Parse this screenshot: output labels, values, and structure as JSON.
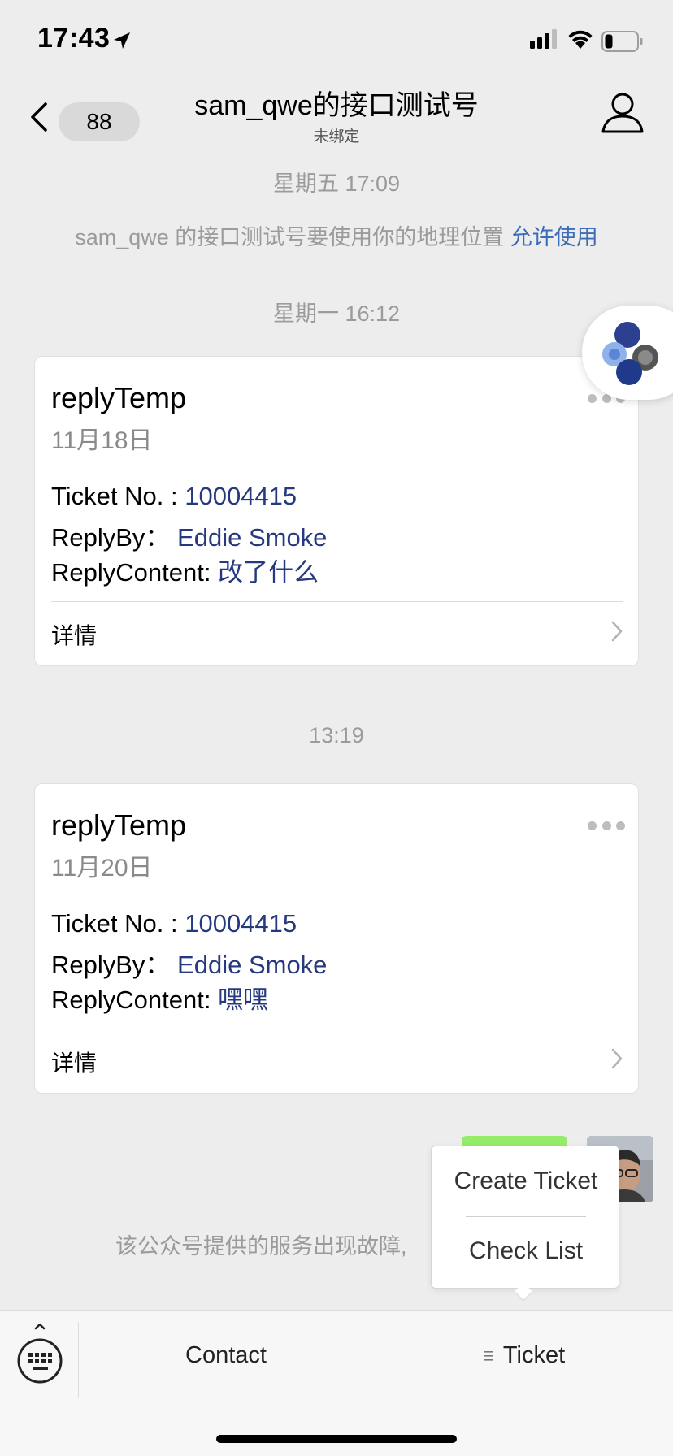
{
  "status_bar": {
    "time": "17:43"
  },
  "nav": {
    "unread_count": "88",
    "title": "sam_qwe的接口测试号",
    "subtitle": "未绑定"
  },
  "messages": {
    "timestamp_1": "星期五 17:09",
    "system_text": "sam_qwe 的接口测试号要使用你的地理位置",
    "system_link": "允许使用",
    "timestamp_2": "星期一 16:12",
    "timestamp_3": "13:19",
    "service_error": "该公众号提供的服务出现故障,"
  },
  "cards": [
    {
      "title": "replyTemp",
      "date": "11月18日",
      "ticket_label": "Ticket No. : ",
      "ticket_value": "10004415",
      "replyby_label": "ReplyBy： ",
      "replyby_value": "Eddie Smoke",
      "content_label": "ReplyContent: ",
      "content_value": "改了什么",
      "detail_label": "详情"
    },
    {
      "title": "replyTemp",
      "date": "11月20日",
      "ticket_label": "Ticket No. : ",
      "ticket_value": "10004415",
      "replyby_label": "ReplyBy： ",
      "replyby_value": "Eddie Smoke",
      "content_label": "ReplyContent: ",
      "content_value": "嘿嘿",
      "detail_label": "详情"
    }
  ],
  "popup_menu": {
    "items": [
      "Create Ticket",
      "Check List"
    ]
  },
  "bottom_menu": {
    "contact_label": "Contact",
    "ticket_label": "Ticket"
  },
  "colors": {
    "link": "#3d6db6",
    "value": "#26397e",
    "bubble_green": "#95ec69",
    "background": "#ededed"
  },
  "icons": {
    "back": "chevron-left-icon",
    "profile": "person-icon",
    "more": "ellipsis-icon",
    "detail": "chevron-right-icon",
    "keyboard": "keyboard-icon",
    "menu": "menu-lines-icon"
  }
}
